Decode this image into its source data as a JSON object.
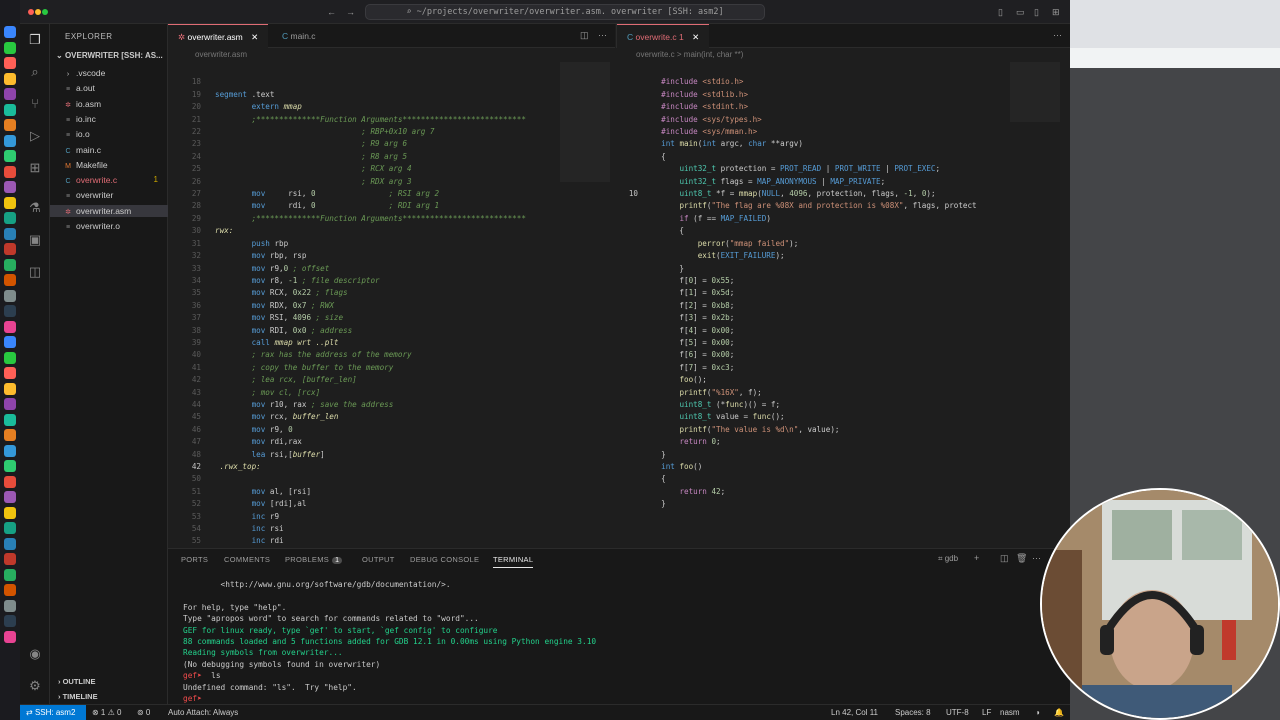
{
  "window": {
    "command_center": "~/projects/overwriter/overwriter.asm. overwriter [SSH: asm2]"
  },
  "sidebar": {
    "header": "EXPLORER",
    "project": "OVERWRITER [SSH: AS...",
    "items": [
      {
        "label": ".vscode",
        "icon": "chevron-right",
        "color": "#cccccc"
      },
      {
        "label": "a.out",
        "icon": "file",
        "color": "#cccccc"
      },
      {
        "label": "io.asm",
        "icon": "asm",
        "color": "#cccccc"
      },
      {
        "label": "io.inc",
        "icon": "file",
        "color": "#cccccc"
      },
      {
        "label": "io.o",
        "icon": "file",
        "color": "#cccccc"
      },
      {
        "label": "main.c",
        "icon": "c",
        "color": "#cccccc"
      },
      {
        "label": "Makefile",
        "icon": "makefile",
        "color": "#cccccc"
      },
      {
        "label": "overwrite.c",
        "icon": "c",
        "color": "#e06c75",
        "badge": "1"
      },
      {
        "label": "overwriter",
        "icon": "file",
        "color": "#cccccc"
      },
      {
        "label": "overwriter.asm",
        "icon": "asm",
        "color": "#cccccc",
        "active": true
      },
      {
        "label": "overwriter.o",
        "icon": "file",
        "color": "#cccccc"
      }
    ],
    "outline": "OUTLINE",
    "timeline": "TIMELINE"
  },
  "left_editor": {
    "tabs": [
      {
        "label": "overwriter.asm",
        "active": true
      },
      {
        "label": "main.c",
        "active": false
      }
    ],
    "breadcrumb": "overwriter.asm",
    "cursor_line": "42"
  },
  "right_editor": {
    "tabs": [
      {
        "label": "overwrite.c 1",
        "active": true
      }
    ],
    "breadcrumb": "overwrite.c  >  main(int, char **)",
    "cursor_line": "10"
  },
  "panel": {
    "tabs": [
      "PORTS",
      "COMMENTS",
      "PROBLEMS",
      "OUTPUT",
      "DEBUG CONSOLE",
      "TERMINAL"
    ],
    "problems_count": "1",
    "active_tab": "TERMINAL",
    "terminal_name": "gdb",
    "terminal_lines": [
      "        <http://www.gnu.org/software/gdb/documentation/>.",
      "",
      "For help, type \"help\".",
      "Type \"apropos word\" to search for commands related to \"word\"...",
      "GEF for linux ready, type `gef' to start, `gef config' to configure",
      "88 commands loaded and 5 functions added for GDB 12.1 in 0.00ms using Python engine 3.10",
      "Reading symbols from overwriter...",
      "(No debugging symbols found in overwriter)",
      "gef➤  ls",
      "Undefined command: \"ls\".  Try \"help\".",
      "gef➤  "
    ]
  },
  "status": {
    "remote": "SSH: asm2",
    "errors": "⊗ 1  ⚠ 0",
    "ports": "⊚ 0",
    "auto_attach": "Auto Attach: Always",
    "position": "Ln 42, Col 11",
    "spaces": "Spaces: 8",
    "encoding": "UTF-8",
    "eol": "LF",
    "language": "nasm"
  }
}
